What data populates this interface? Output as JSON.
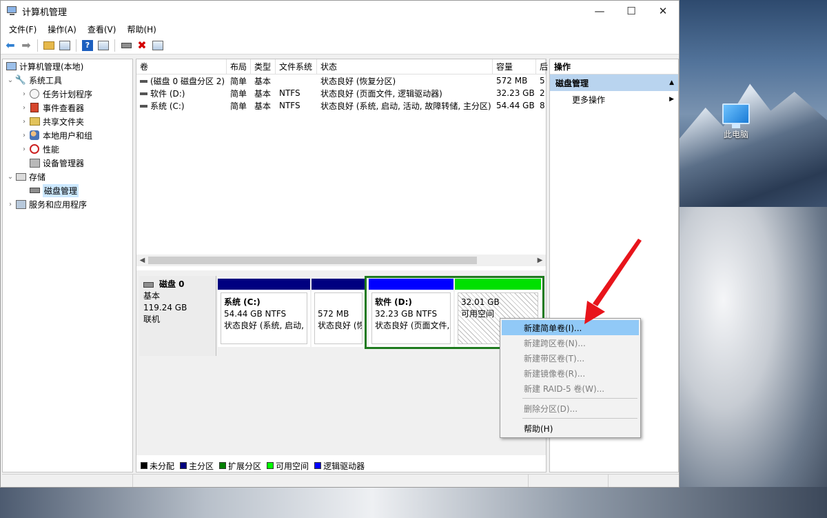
{
  "window": {
    "title": "计算机管理",
    "minimize": "—",
    "maximize": "☐",
    "close": "✕"
  },
  "menu": [
    "文件(F)",
    "操作(A)",
    "查看(V)",
    "帮助(H)"
  ],
  "tree": {
    "root": "计算机管理(本地)",
    "system_tools": "系统工具",
    "task_scheduler": "任务计划程序",
    "event_viewer": "事件查看器",
    "shared_folders": "共享文件夹",
    "local_users": "本地用户和组",
    "performance": "性能",
    "device_manager": "设备管理器",
    "storage": "存储",
    "disk_management": "磁盘管理",
    "services": "服务和应用程序"
  },
  "volume_table": {
    "headers": [
      "卷",
      "布局",
      "类型",
      "文件系统",
      "状态",
      "容量",
      "后"
    ],
    "rows": [
      [
        "(磁盘 0 磁盘分区 2)",
        "简单",
        "基本",
        "",
        "状态良好 (恢复分区)",
        "572 MB",
        "5"
      ],
      [
        "软件 (D:)",
        "简单",
        "基本",
        "NTFS",
        "状态良好 (页面文件, 逻辑驱动器)",
        "32.23 GB",
        "2"
      ],
      [
        "系统 (C:)",
        "简单",
        "基本",
        "NTFS",
        "状态良好 (系统, 启动, 活动, 故障转储, 主分区)",
        "54.44 GB",
        "8"
      ]
    ]
  },
  "disk": {
    "name": "磁盘 0",
    "type": "基本",
    "size": "119.24 GB",
    "status": "联机",
    "partitions": [
      {
        "title": "系统  (C:)",
        "size": "54.44 GB NTFS",
        "status": "状态良好 (系统, 启动, 活动, 故障转储, 主分区)",
        "color": "#000080"
      },
      {
        "title": "",
        "size": "572 MB",
        "status": "状态良好 (恢复分区)",
        "color": "#000080"
      },
      {
        "title": "软件  (D:)",
        "size": "32.23 GB NTFS",
        "status": "状态良好 (页面文件, 逻辑驱动器)",
        "color": "#0000ff"
      },
      {
        "title": "",
        "size": "32.01 GB",
        "status": "可用空间",
        "color": "#00e000"
      }
    ]
  },
  "legend": [
    {
      "label": "未分配",
      "color": "#000000"
    },
    {
      "label": "主分区",
      "color": "#000080"
    },
    {
      "label": "扩展分区",
      "color": "#008000"
    },
    {
      "label": "可用空间",
      "color": "#00ff00"
    },
    {
      "label": "逻辑驱动器",
      "color": "#0000ff"
    }
  ],
  "actions": {
    "header": "操作",
    "section": "磁盘管理",
    "more": "更多操作"
  },
  "context_menu": {
    "new_simple": "新建简单卷(I)...",
    "new_spanned": "新建跨区卷(N)...",
    "new_striped": "新建带区卷(T)...",
    "new_mirrored": "新建镜像卷(R)...",
    "new_raid5": "新建 RAID-5 卷(W)...",
    "delete_partition": "删除分区(D)...",
    "help": "帮助(H)"
  },
  "desktop": {
    "this_pc": "此电脑"
  },
  "colors": {
    "arrow": "#e8141b",
    "highlight": "#91c9f7"
  }
}
